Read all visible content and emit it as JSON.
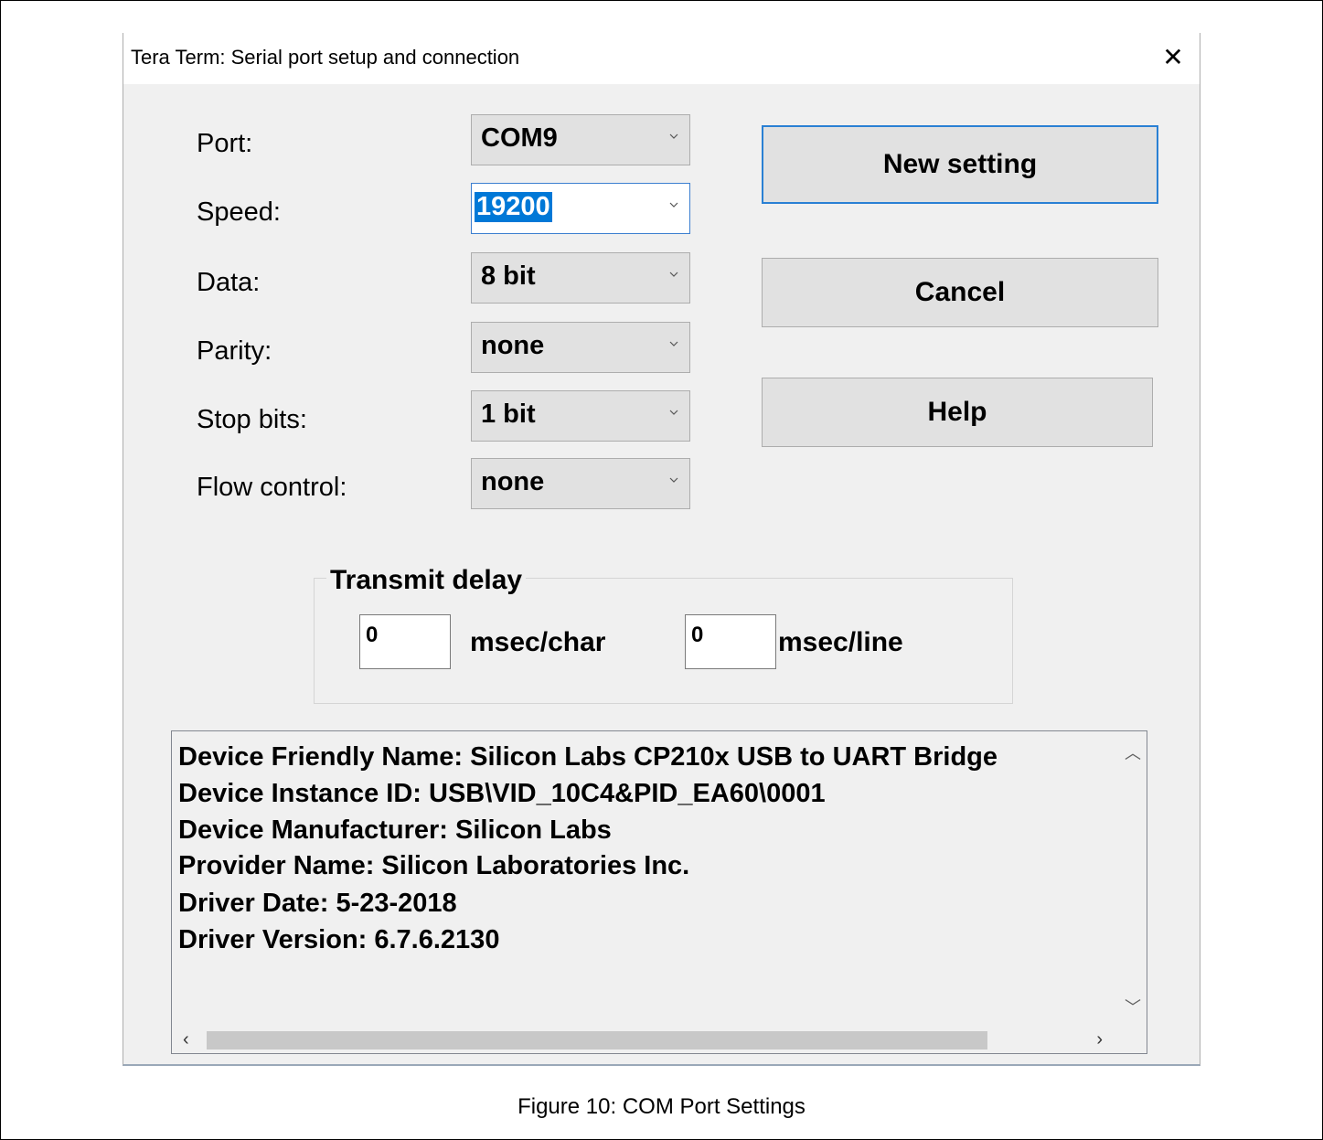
{
  "dialog": {
    "title": "Tera Term: Serial port setup and connection"
  },
  "fields": {
    "port": {
      "label": "Port:",
      "value": "COM9"
    },
    "speed": {
      "label": "Speed:",
      "value": "19200"
    },
    "data": {
      "label": "Data:",
      "value": "8 bit"
    },
    "parity": {
      "label": "Parity:",
      "value": "none"
    },
    "stop_bits": {
      "label": "Stop bits:",
      "value": "1 bit"
    },
    "flow_control": {
      "label": "Flow control:",
      "value": "none"
    }
  },
  "buttons": {
    "new_setting": "New setting",
    "cancel": "Cancel",
    "help": "Help"
  },
  "transmit_delay": {
    "label": "Transmit delay",
    "char_value": "0",
    "char_unit": "msec/char",
    "line_value": "0",
    "line_unit": "msec/line"
  },
  "device_info": [
    "Device Friendly Name: Silicon Labs CP210x USB to UART Bridge",
    "Device Instance ID: USB\\VID_10C4&PID_EA60\\0001",
    "Device Manufacturer: Silicon Labs",
    "Provider Name: Silicon Laboratories Inc.",
    "Driver Date: 5-23-2018",
    "Driver Version: 6.7.6.2130"
  ],
  "caption": "Figure 10: COM Port Settings",
  "colors": {
    "dialog_bg": "#f0f0f0",
    "focus_blue": "#0078d7",
    "default_button_border": "#2a80d4"
  }
}
